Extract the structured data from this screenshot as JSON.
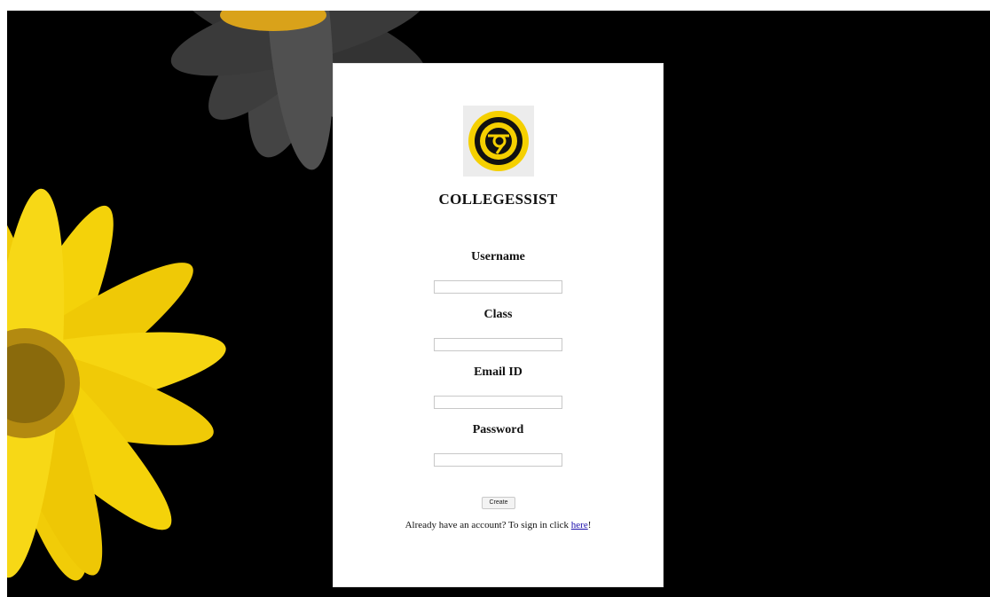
{
  "app": {
    "name": "COLLEGESSIST",
    "logo_icon": "chrome-like-logo-icon",
    "accent_color": "#f5d000"
  },
  "form": {
    "fields": [
      {
        "label": "Username",
        "value": ""
      },
      {
        "label": "Class",
        "value": ""
      },
      {
        "label": "Email ID",
        "value": ""
      },
      {
        "label": "Password",
        "value": ""
      }
    ],
    "create_label": "Create",
    "signin_text": "Already have an account? To sign in click ",
    "signin_link": "here",
    "signin_suffix": "!"
  },
  "background": {
    "color": "#000000",
    "image": "yellow-daisy-flowers",
    "petal_color": "#f4d20a"
  }
}
